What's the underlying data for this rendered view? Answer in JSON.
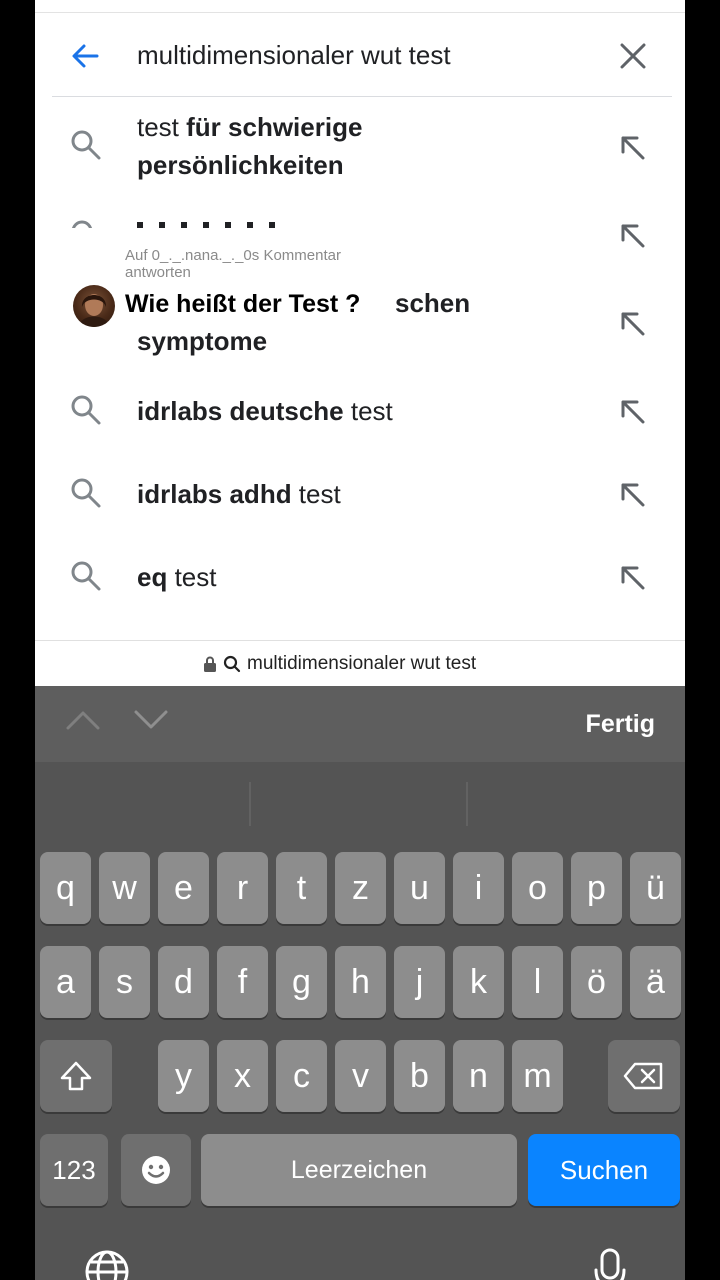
{
  "search": {
    "query": "multidimensionaler wut test"
  },
  "suggestions": [
    {
      "line1_plain": "test ",
      "line1_bold": "für schwierige",
      "line2_bold": "persönlichkeiten"
    },
    {
      "line1_plain": "",
      "line1_bold": "",
      "line2_bold": ""
    },
    {
      "line1_bold_tail": "schen",
      "line2_bold": "symptome"
    },
    {
      "bold": "idrlabs deutsche",
      "plain": " test"
    },
    {
      "bold": "idrlabs adhd",
      "plain": " test"
    },
    {
      "bold": "eq",
      "plain": " test"
    }
  ],
  "comment": {
    "meta": "Auf 0_._.nana._._0s Kommentar antworten",
    "text": "Wie heißt der Test ?"
  },
  "url_bar": {
    "text": "multidimensionaler wut test"
  },
  "keyboard": {
    "done_label": "Fertig",
    "row1": [
      "q",
      "w",
      "e",
      "r",
      "t",
      "z",
      "u",
      "i",
      "o",
      "p",
      "ü"
    ],
    "row2": [
      "a",
      "s",
      "d",
      "f",
      "g",
      "h",
      "j",
      "k",
      "l",
      "ö",
      "ä"
    ],
    "row3": [
      "y",
      "x",
      "c",
      "v",
      "b",
      "n",
      "m"
    ],
    "numbers_label": "123",
    "space_label": "Leerzeichen",
    "search_label": "Suchen"
  },
  "colors": {
    "accent": "#1a73e8",
    "keyboard_bg": "#545454",
    "key_bg": "#8d8d8d",
    "search_key": "#0a84ff"
  }
}
